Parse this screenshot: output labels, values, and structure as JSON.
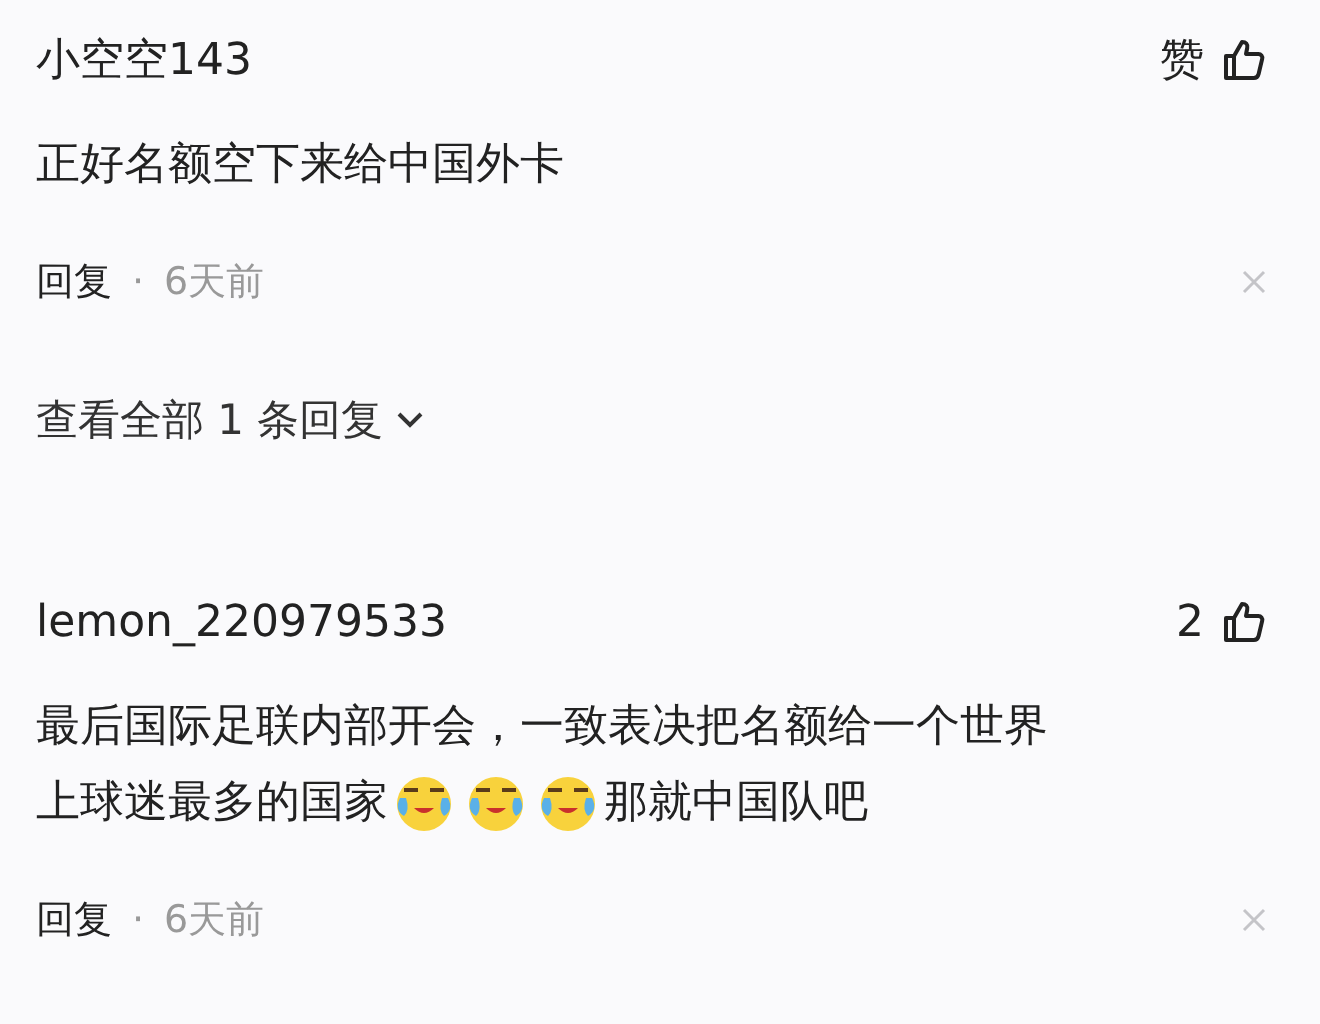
{
  "comments": [
    {
      "username": "小空空143",
      "likes": "赞",
      "lines": [
        [
          {
            "kind": "text",
            "text": "正好名额空下来给中国外卡"
          }
        ]
      ],
      "reply": "回复",
      "separator": "·",
      "time": "6天前",
      "view_replies": "查看全部 1 条回复"
    },
    {
      "username": "lemon_220979533",
      "likes": "2",
      "lines": [
        [
          {
            "kind": "text",
            "text": "最后国际足联内部开会，一致表决把名额给一个世界"
          }
        ],
        [
          {
            "kind": "text",
            "text": "上球迷最多的国家"
          },
          {
            "kind": "emoji"
          },
          {
            "kind": "emoji"
          },
          {
            "kind": "emoji"
          },
          {
            "kind": "text",
            "text": "那就中国队吧"
          }
        ]
      ],
      "reply": "回复",
      "separator": "·",
      "time": "6天前"
    }
  ]
}
